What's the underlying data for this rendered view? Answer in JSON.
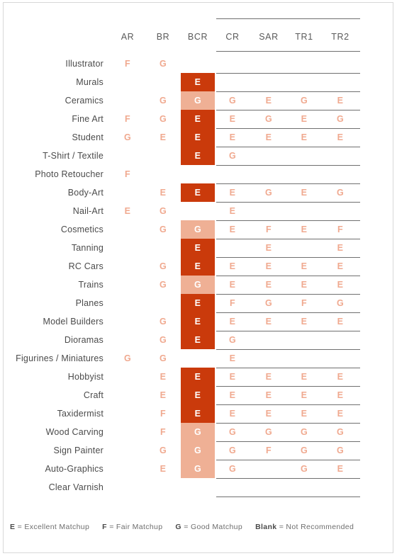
{
  "table": {
    "columns": [
      "AR",
      "BR",
      "BCR",
      "CR",
      "SAR",
      "TR1",
      "TR2"
    ],
    "highlight_column": "BCR",
    "rows": [
      {
        "label": "Illustrator",
        "values": [
          "F",
          "G",
          "",
          "",
          "",
          "",
          ""
        ]
      },
      {
        "label": "Murals",
        "values": [
          "",
          "",
          "E",
          "",
          "",
          "",
          ""
        ]
      },
      {
        "label": "Ceramics",
        "values": [
          "",
          "G",
          "G",
          "G",
          "E",
          "G",
          "E"
        ]
      },
      {
        "label": "Fine Art",
        "values": [
          "F",
          "G",
          "E",
          "E",
          "G",
          "E",
          "G"
        ]
      },
      {
        "label": "Student",
        "values": [
          "G",
          "E",
          "E",
          "E",
          "E",
          "E",
          "E"
        ]
      },
      {
        "label": "T-Shirt / Textile",
        "values": [
          "",
          "",
          "E",
          "G",
          "",
          "",
          ""
        ]
      },
      {
        "label": "Photo Retoucher",
        "values": [
          "F",
          "",
          "",
          "",
          "",
          "",
          ""
        ]
      },
      {
        "label": "Body-Art",
        "values": [
          "",
          "E",
          "E",
          "E",
          "G",
          "E",
          "G"
        ]
      },
      {
        "label": "Nail-Art",
        "values": [
          "E",
          "G",
          "",
          "E",
          "",
          "",
          ""
        ]
      },
      {
        "label": "Cosmetics",
        "values": [
          "",
          "G",
          "G",
          "E",
          "F",
          "E",
          "F"
        ]
      },
      {
        "label": "Tanning",
        "values": [
          "",
          "",
          "E",
          "",
          "E",
          "",
          "E"
        ]
      },
      {
        "label": "RC Cars",
        "values": [
          "",
          "G",
          "E",
          "E",
          "E",
          "E",
          "E"
        ]
      },
      {
        "label": "Trains",
        "values": [
          "",
          "G",
          "G",
          "E",
          "E",
          "E",
          "E"
        ]
      },
      {
        "label": "Planes",
        "values": [
          "",
          "",
          "E",
          "F",
          "G",
          "F",
          "G"
        ]
      },
      {
        "label": "Model Builders",
        "values": [
          "",
          "G",
          "E",
          "E",
          "E",
          "E",
          "E"
        ]
      },
      {
        "label": "Dioramas",
        "values": [
          "",
          "G",
          "E",
          "G",
          "",
          "",
          ""
        ]
      },
      {
        "label": "Figurines / Miniatures",
        "values": [
          "G",
          "G",
          "",
          "E",
          "",
          "",
          ""
        ]
      },
      {
        "label": "Hobbyist",
        "values": [
          "",
          "E",
          "E",
          "E",
          "E",
          "E",
          "E"
        ]
      },
      {
        "label": "Craft",
        "values": [
          "",
          "E",
          "E",
          "E",
          "E",
          "E",
          "E"
        ]
      },
      {
        "label": "Taxidermist",
        "values": [
          "",
          "F",
          "E",
          "E",
          "E",
          "E",
          "E"
        ]
      },
      {
        "label": "Wood Carving",
        "values": [
          "",
          "F",
          "G",
          "G",
          "G",
          "G",
          "G"
        ]
      },
      {
        "label": "Sign Painter",
        "values": [
          "",
          "G",
          "G",
          "G",
          "F",
          "G",
          "G"
        ]
      },
      {
        "label": "Auto-Graphics",
        "values": [
          "",
          "E",
          "G",
          "G",
          "",
          "G",
          "E"
        ]
      },
      {
        "label": "Clear Varnish",
        "values": [
          "",
          "",
          "",
          "",
          "",
          "",
          ""
        ]
      }
    ]
  },
  "legend": [
    {
      "key": "E",
      "text": "= Excellent Matchup"
    },
    {
      "key": "F",
      "text": "= Fair Matchup"
    },
    {
      "key": "G",
      "text": "= Good Matchup"
    },
    {
      "key": "Blank",
      "text": "= Not Recommended"
    }
  ],
  "colors": {
    "excellent_fill": "#ca3a0b",
    "good_fill": "#efb095",
    "mark_text": "#f0a98f",
    "label_text": "#4b4b4b",
    "rule": "#6f6f6f"
  }
}
